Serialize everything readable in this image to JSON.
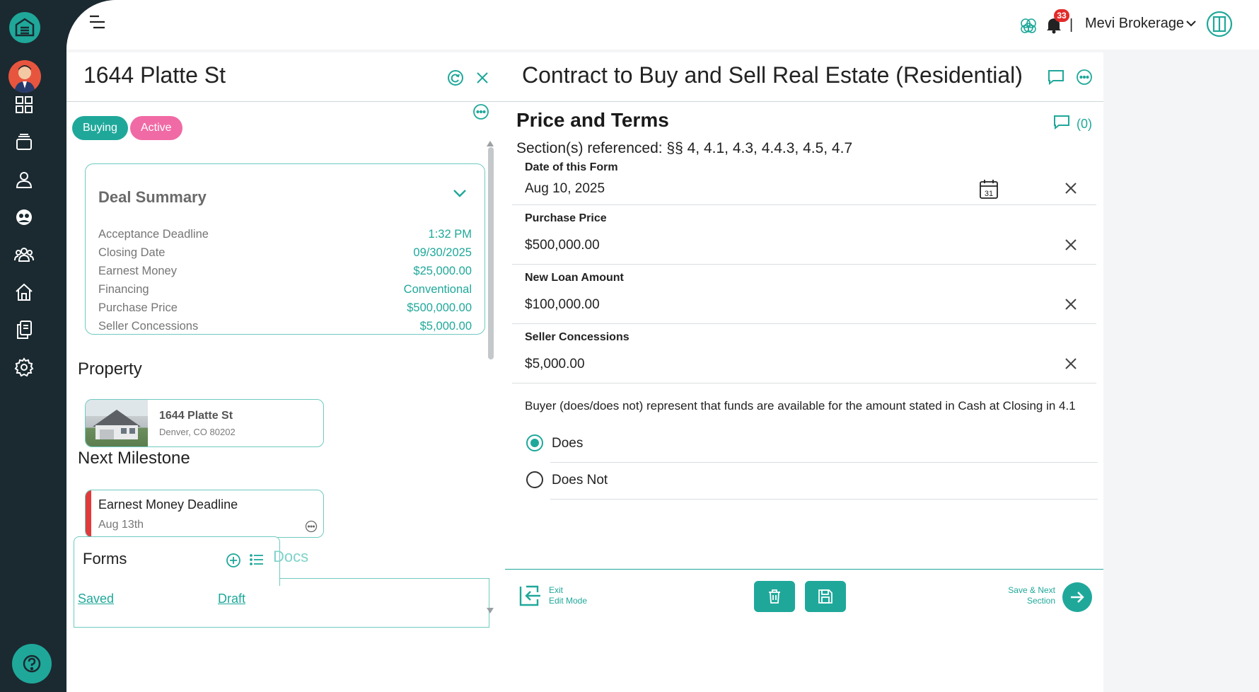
{
  "colors": {
    "accent": "#1fa89a",
    "sidebar_bg": "#1b2a31",
    "pill_buying": "#1fa89a",
    "pill_active": "#f06aa5",
    "milestone_bar": "#e03a3a",
    "notification_badge": "#e22a2a"
  },
  "topbar": {
    "notification_count": "33",
    "separator": "|",
    "brokerage": "Mevi Brokerage"
  },
  "left_panel": {
    "title": "1644 Platte St",
    "pills": [
      "Buying",
      "Active"
    ],
    "deal_summary": {
      "title": "Deal Summary",
      "rows": [
        {
          "label": "Acceptance Deadline",
          "value": "1:32 PM"
        },
        {
          "label": "Closing Date",
          "value": "09/30/2025"
        },
        {
          "label": "Earnest Money",
          "value": "$25,000.00"
        },
        {
          "label": "Financing",
          "value": "Conventional"
        },
        {
          "label": "Purchase Price",
          "value": "$500,000.00"
        },
        {
          "label": "Seller Concessions",
          "value": "$5,000.00"
        }
      ]
    },
    "property_heading": "Property",
    "property": {
      "address": "1644 Platte St",
      "city": "Denver,  CO  80202"
    },
    "milestone_heading": "Next Milestone",
    "milestone": {
      "title": "Earnest Money Deadline",
      "date": "Aug 13th"
    },
    "tabs": {
      "forms": "Forms",
      "docs": "Docs"
    },
    "subtabs": {
      "saved": "Saved",
      "draft": "Draft"
    }
  },
  "right_panel": {
    "title": "Contract to Buy and Sell Real Estate (Residential)",
    "section_title": "Price and Terms",
    "comment_count": "(0)",
    "sections_referenced": "Section(s) referenced: §§ 4, 4.1, 4.3, 4.4.3, 4.5, 4.7",
    "fields": [
      {
        "label": "Date of this Form",
        "value": "Aug 10, 2025",
        "calendar_day": "31"
      },
      {
        "label": "Purchase Price",
        "value": "$500,000.00"
      },
      {
        "label": "New Loan Amount",
        "value": "$100,000.00"
      },
      {
        "label": "Seller Concessions",
        "value": "$5,000.00"
      }
    ],
    "question": "Buyer (does/does not) represent that funds are available for the amount stated in Cash at Closing in 4.1",
    "options": [
      {
        "label": "Does",
        "selected": true
      },
      {
        "label": "Does Not",
        "selected": false
      }
    ],
    "footer": {
      "exit_line1": "Exit",
      "exit_line2": "Edit Mode",
      "save_next_line1": "Save & Next",
      "save_next_line2": "Section"
    }
  }
}
